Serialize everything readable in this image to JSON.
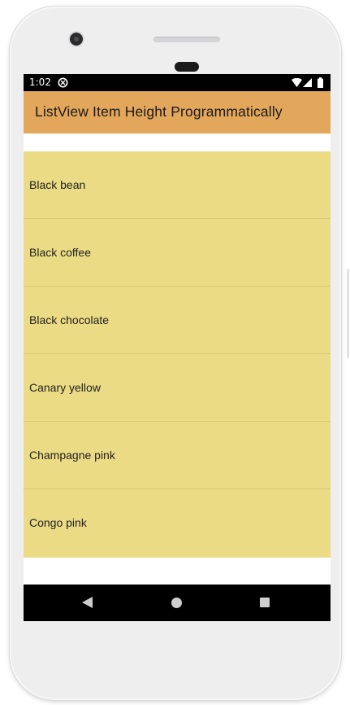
{
  "status_bar": {
    "time": "1:02",
    "icons": [
      "sync-icon",
      "wifi-icon",
      "signal-icon",
      "battery-icon"
    ]
  },
  "app_bar": {
    "title": "ListView Item Height Programmatically",
    "color": "#e3a75c"
  },
  "list": {
    "item_color": "#ebdb84",
    "items": [
      {
        "label": "Black bean"
      },
      {
        "label": "Black coffee"
      },
      {
        "label": "Black chocolate"
      },
      {
        "label": "Canary yellow"
      },
      {
        "label": "Champagne pink"
      },
      {
        "label": "Congo pink"
      }
    ]
  },
  "nav_bar": {
    "buttons": [
      "back-icon",
      "home-icon",
      "recents-icon"
    ]
  }
}
